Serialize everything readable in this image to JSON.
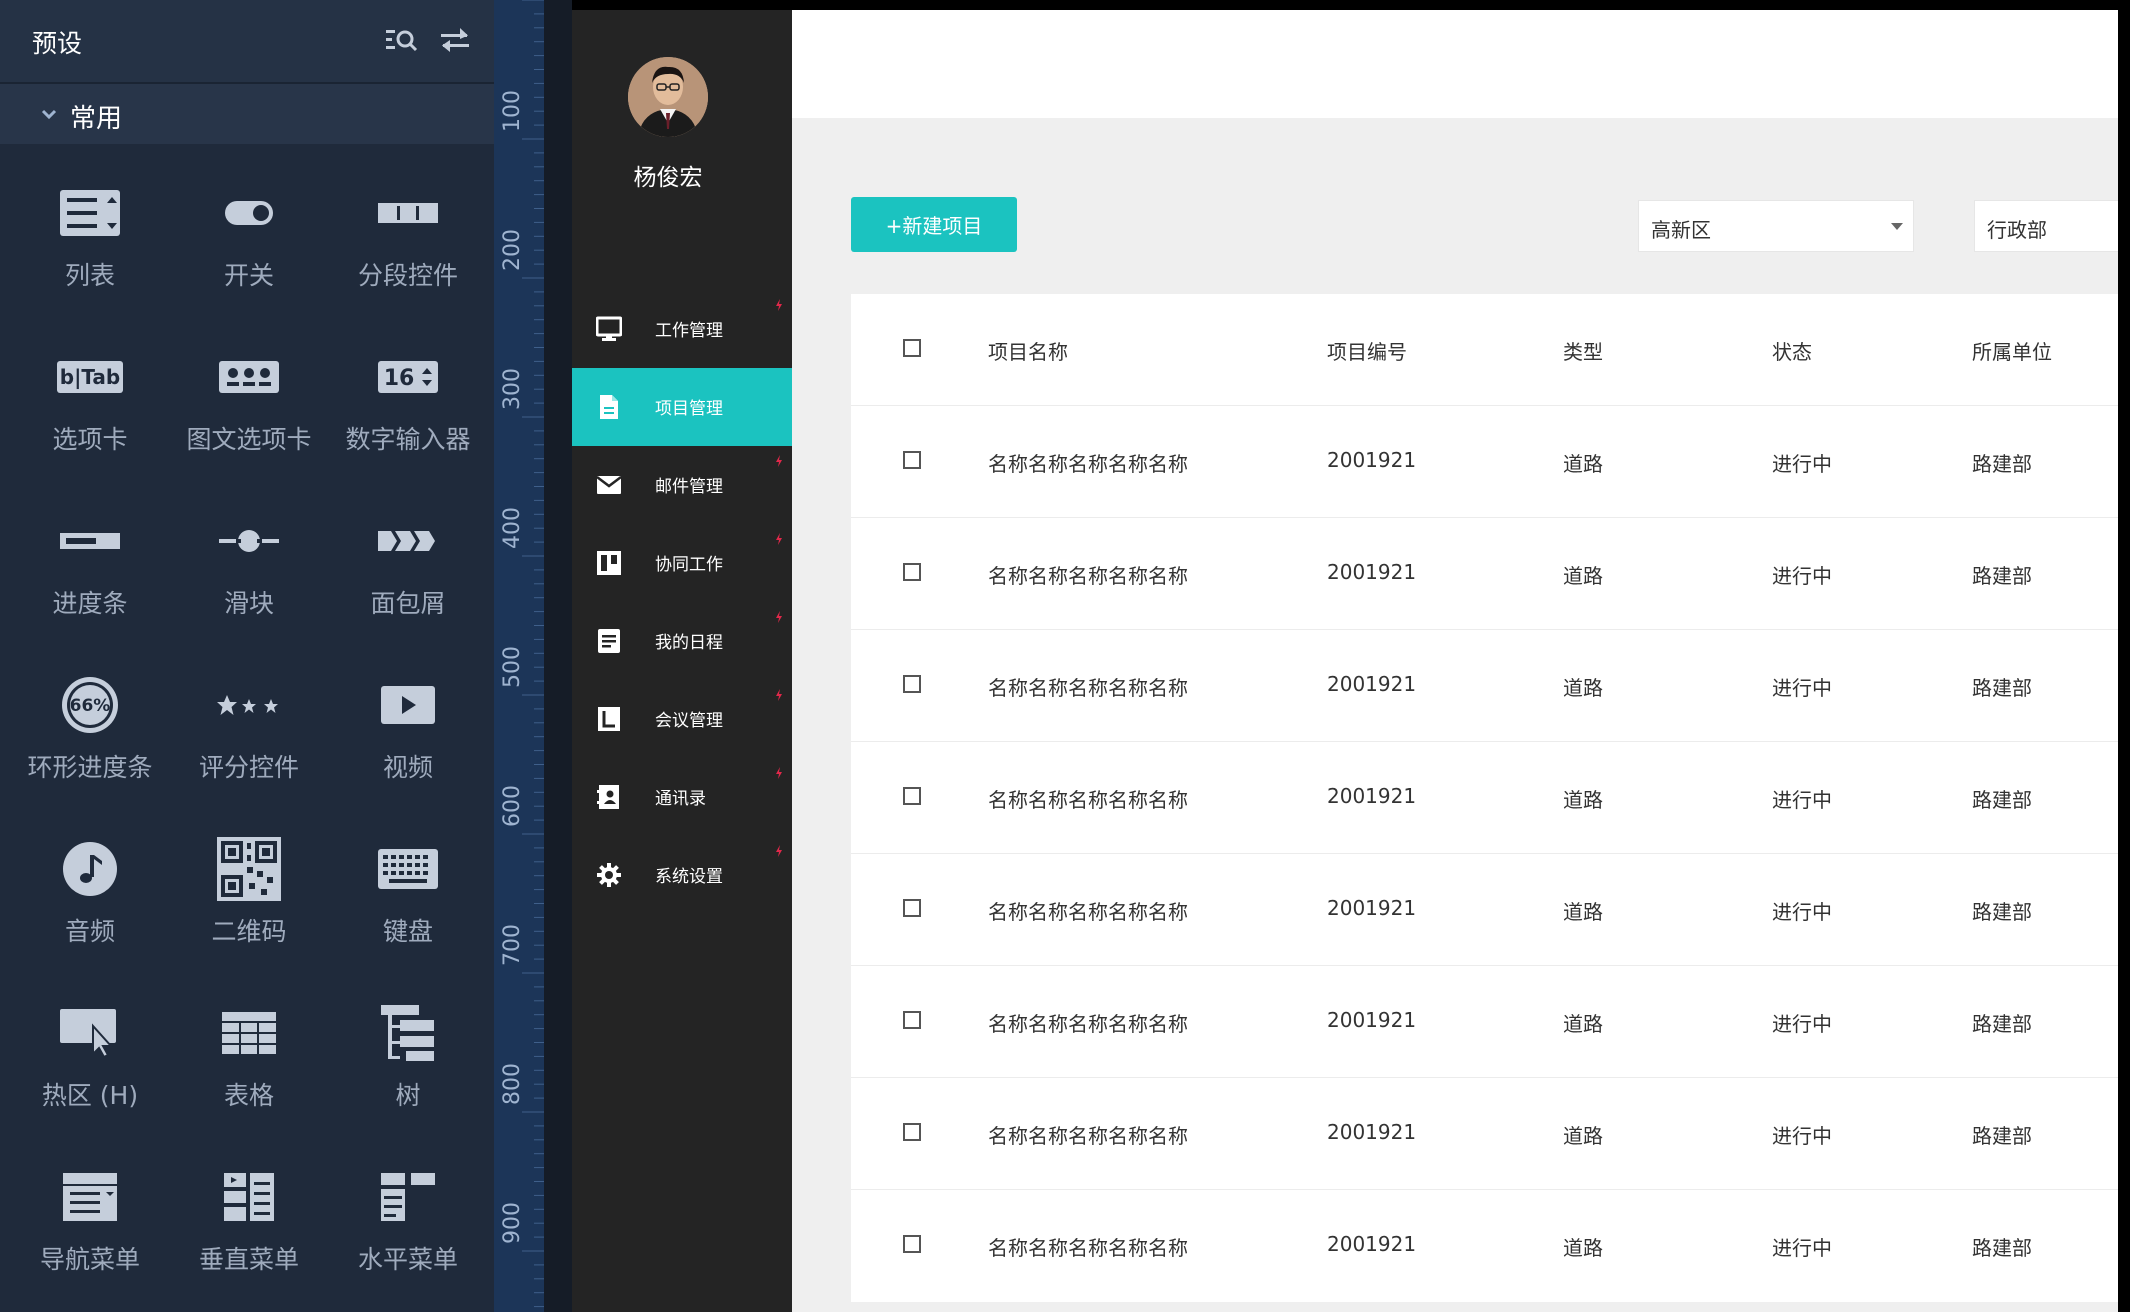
{
  "preset_panel": {
    "title": "预设",
    "group_title": "常用",
    "widgets": [
      {
        "label": "列表",
        "icon": "list-icon"
      },
      {
        "label": "开关",
        "icon": "toggle-icon"
      },
      {
        "label": "分段控件",
        "icon": "segmented-icon"
      },
      {
        "label": "选项卡",
        "icon": "tab-icon",
        "icon_text": "b|Tab"
      },
      {
        "label": "图文选项卡",
        "icon": "image-tab-icon"
      },
      {
        "label": "数字输入器",
        "icon": "number-input-icon",
        "icon_text": "16"
      },
      {
        "label": "进度条",
        "icon": "progress-bar-icon"
      },
      {
        "label": "滑块",
        "icon": "slider-icon"
      },
      {
        "label": "面包屑",
        "icon": "breadcrumb-icon"
      },
      {
        "label": "环形进度条",
        "icon": "ring-progress-icon",
        "icon_text": "66%"
      },
      {
        "label": "评分控件",
        "icon": "rating-icon"
      },
      {
        "label": "视频",
        "icon": "video-icon"
      },
      {
        "label": "音频",
        "icon": "audio-icon"
      },
      {
        "label": "二维码",
        "icon": "qrcode-icon"
      },
      {
        "label": "键盘",
        "icon": "keyboard-icon"
      },
      {
        "label": "热区 (H)",
        "icon": "hotspot-icon"
      },
      {
        "label": "表格",
        "icon": "table-icon"
      },
      {
        "label": "树",
        "icon": "tree-icon"
      },
      {
        "label": "导航菜单",
        "icon": "nav-menu-icon"
      },
      {
        "label": "垂直菜单",
        "icon": "vertical-menu-icon"
      },
      {
        "label": "水平菜单",
        "icon": "horizontal-menu-icon"
      }
    ]
  },
  "ruler": {
    "labels": [
      "100",
      "200",
      "300",
      "400",
      "500",
      "600",
      "700",
      "800",
      "900"
    ]
  },
  "sidebar": {
    "user_name": "杨俊宏",
    "items": [
      {
        "label": "工作管理",
        "icon": "monitor-icon",
        "active": false
      },
      {
        "label": "项目管理",
        "icon": "document-icon",
        "active": true
      },
      {
        "label": "邮件管理",
        "icon": "mail-icon",
        "active": false
      },
      {
        "label": "协同工作",
        "icon": "board-icon",
        "active": false
      },
      {
        "label": "我的日程",
        "icon": "notes-icon",
        "active": false
      },
      {
        "label": "会议管理",
        "icon": "meeting-icon",
        "active": false
      },
      {
        "label": "通讯录",
        "icon": "contacts-icon",
        "active": false
      },
      {
        "label": "系统设置",
        "icon": "gear-icon",
        "active": false
      }
    ]
  },
  "toolbar": {
    "new_button": "+新建项目",
    "district_select": "高新区",
    "dept_select": "行政部"
  },
  "table": {
    "columns": [
      "项目名称",
      "项目编号",
      "类型",
      "状态",
      "所属单位"
    ],
    "rows": [
      [
        "名称名称名称名称名称",
        "2001921",
        "道路",
        "进行中",
        "路建部"
      ],
      [
        "名称名称名称名称名称",
        "2001921",
        "道路",
        "进行中",
        "路建部"
      ],
      [
        "名称名称名称名称名称",
        "2001921",
        "道路",
        "进行中",
        "路建部"
      ],
      [
        "名称名称名称名称名称",
        "2001921",
        "道路",
        "进行中",
        "路建部"
      ],
      [
        "名称名称名称名称名称",
        "2001921",
        "道路",
        "进行中",
        "路建部"
      ],
      [
        "名称名称名称名称名称",
        "2001921",
        "道路",
        "进行中",
        "路建部"
      ],
      [
        "名称名称名称名称名称",
        "2001921",
        "道路",
        "进行中",
        "路建部"
      ],
      [
        "名称名称名称名称名称",
        "2001921",
        "道路",
        "进行中",
        "路建部"
      ]
    ]
  },
  "colors": {
    "accent": "#1bc3c0",
    "panel_bg": "#1f2a3b",
    "sidebar_bg": "#242424",
    "marker": "#e0284a"
  }
}
